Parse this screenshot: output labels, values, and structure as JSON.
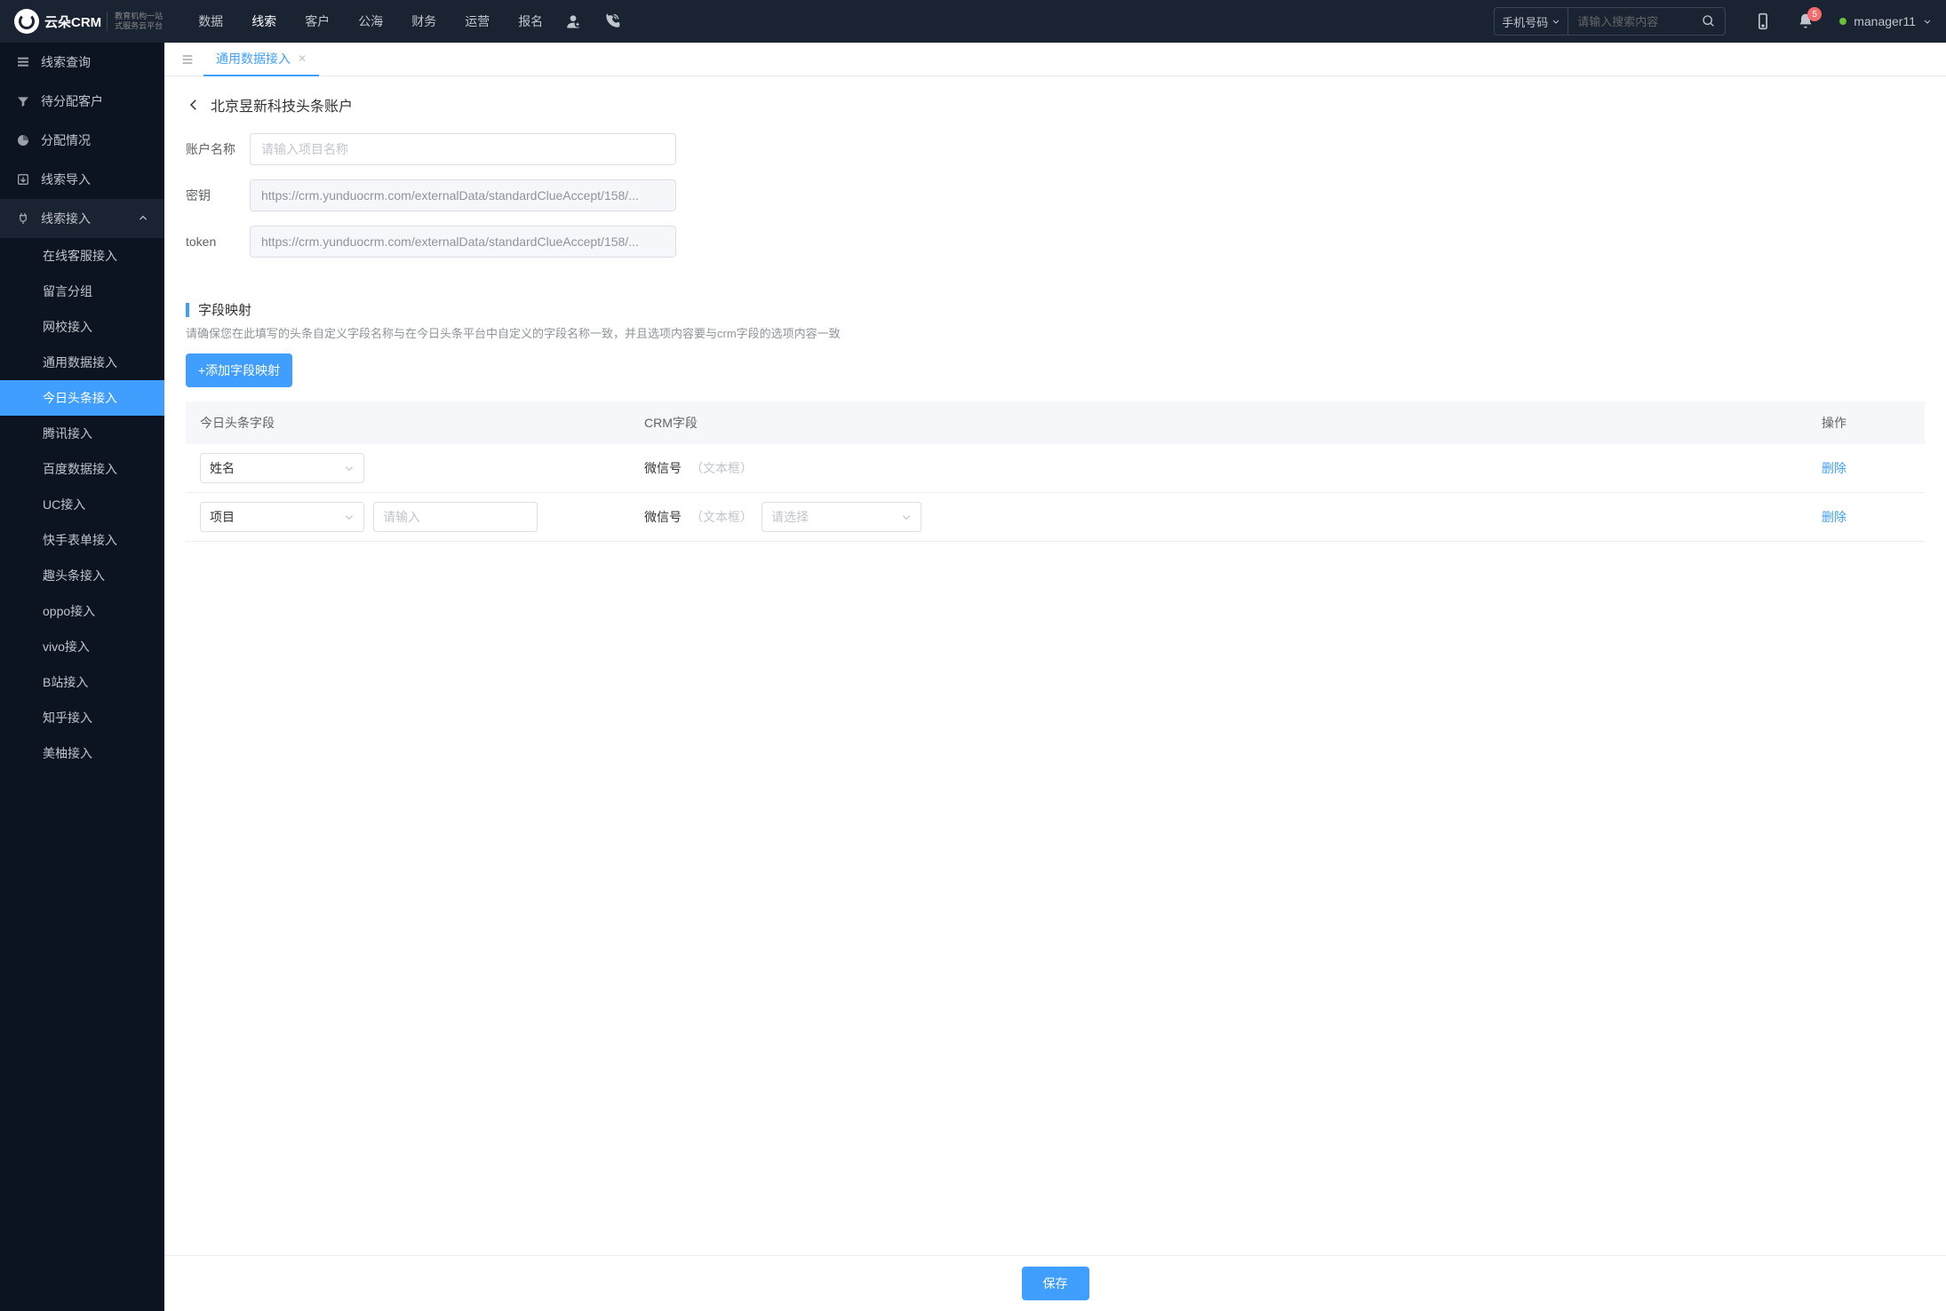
{
  "brand": {
    "name": "云朵CRM",
    "tagline1": "教育机构一站",
    "tagline2": "式服务云平台",
    "url": "www.yunduocrm.com"
  },
  "nav": {
    "items": [
      "数据",
      "线索",
      "客户",
      "公海",
      "财务",
      "运营",
      "报名"
    ],
    "activeIndex": 1
  },
  "search": {
    "selectLabel": "手机号码",
    "placeholder": "请输入搜索内容"
  },
  "notifications": {
    "count": "5"
  },
  "user": {
    "name": "manager11"
  },
  "sidebar": {
    "items": [
      {
        "label": "线索查询",
        "icon": "list"
      },
      {
        "label": "待分配客户",
        "icon": "filter"
      },
      {
        "label": "分配情况",
        "icon": "pie"
      },
      {
        "label": "线索导入",
        "icon": "export"
      },
      {
        "label": "线索接入",
        "icon": "plug",
        "expanded": true,
        "children": [
          "在线客服接入",
          "留言分组",
          "网校接入",
          "通用数据接入",
          "今日头条接入",
          "腾讯接入",
          "百度数据接入",
          "UC接入",
          "快手表单接入",
          "趣头条接入",
          "oppo接入",
          "vivo接入",
          "B站接入",
          "知乎接入",
          "美柚接入"
        ],
        "activeChild": 4
      }
    ]
  },
  "tabs": {
    "items": [
      {
        "label": "通用数据接入"
      }
    ],
    "activeIndex": 0
  },
  "page": {
    "title": "北京昱新科技头条账户",
    "form": {
      "accountLabel": "账户名称",
      "accountPlaceholder": "请输入项目名称",
      "secretLabel": "密钥",
      "secretValue": "https://crm.yunduocrm.com/externalData/standardClueAccept/158/...",
      "tokenLabel": "token",
      "tokenValue": "https://crm.yunduocrm.com/externalData/standardClueAccept/158/..."
    },
    "mapping": {
      "title": "字段映射",
      "desc": "请确保您在此填写的头条自定义字段名称与在今日头条平台中自定义的字段名称一致，并且选项内容要与crm字段的选项内容一致",
      "addBtn": "+添加字段映射",
      "headers": {
        "c1": "今日头条字段",
        "c2": "CRM字段",
        "c3": "操作"
      },
      "rows": [
        {
          "field": "姓名",
          "crmLabel": "微信号",
          "crmHint": "（文本框）",
          "delete": "删除"
        },
        {
          "field": "项目",
          "inputPlaceholder": "请输入",
          "crmLabel": "微信号",
          "crmHint": "（文本框）",
          "selectPlaceholder": "请选择",
          "delete": "删除"
        }
      ]
    },
    "saveBtn": "保存"
  }
}
